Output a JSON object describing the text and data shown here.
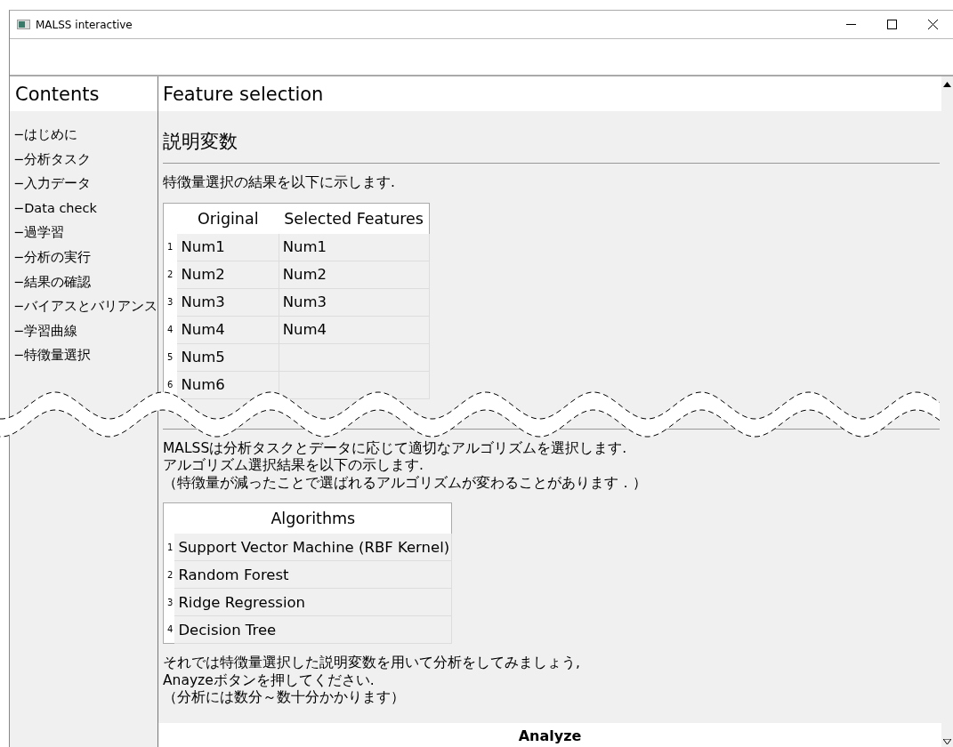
{
  "window": {
    "title": "MALSS interactive"
  },
  "sidebar": {
    "title": "Contents",
    "items": [
      {
        "label": "−はじめに"
      },
      {
        "label": "−分析タスク"
      },
      {
        "label": "−入力データ"
      },
      {
        "label": "−Data check"
      },
      {
        "label": "−過学習"
      },
      {
        "label": "−分析の実行"
      },
      {
        "label": "−結果の確認"
      },
      {
        "label": "−バイアスとバリアンス"
      },
      {
        "label": "−学習曲線"
      },
      {
        "label": "−特徴量選択"
      }
    ]
  },
  "content": {
    "title": "Feature selection",
    "blocks": [
      {
        "kind": "heading",
        "text": "説明変数"
      },
      {
        "kind": "paragraph",
        "text": "特徴量選択の結果を以下に示します."
      },
      {
        "kind": "table",
        "columns": [
          "Original",
          "Selected Features"
        ],
        "rows": [
          {
            "index": "1",
            "cells": [
              "Num1",
              "Num1"
            ]
          },
          {
            "index": "2",
            "cells": [
              "Num2",
              "Num2"
            ]
          },
          {
            "index": "3",
            "cells": [
              "Num3",
              "Num3"
            ]
          },
          {
            "index": "4",
            "cells": [
              "Num4",
              "Num4"
            ]
          },
          {
            "index": "5",
            "cells": [
              "Num5"
            ]
          },
          {
            "index": "6",
            "cells": [
              "Num6"
            ]
          }
        ]
      },
      {
        "kind": "rule"
      },
      {
        "kind": "paragraph",
        "text": "MALSSは分析タスクとデータに応じて適切なアルゴリズムを選択します.\nアルゴリズム選択結果を以下の示します.\n（特徴量が減ったことで選ばれるアルゴリズムが変わることがあります．）"
      },
      {
        "kind": "table",
        "columns": [
          "Algorithms"
        ],
        "rows": [
          {
            "index": "1",
            "cells": [
              "Support Vector Machine (RBF Kernel)"
            ]
          },
          {
            "index": "2",
            "cells": [
              "Random Forest"
            ]
          },
          {
            "index": "3",
            "cells": [
              "Ridge Regression"
            ]
          },
          {
            "index": "4",
            "cells": [
              "Decision Tree"
            ]
          }
        ]
      },
      {
        "kind": "paragraph",
        "text": "それでは特徴量選択した説明変数を用いて分析をしてみましょう,\nAnayzeボタンを押してください.\n（分析には数分～数十分かかります）"
      }
    ],
    "button": "Analyze"
  }
}
